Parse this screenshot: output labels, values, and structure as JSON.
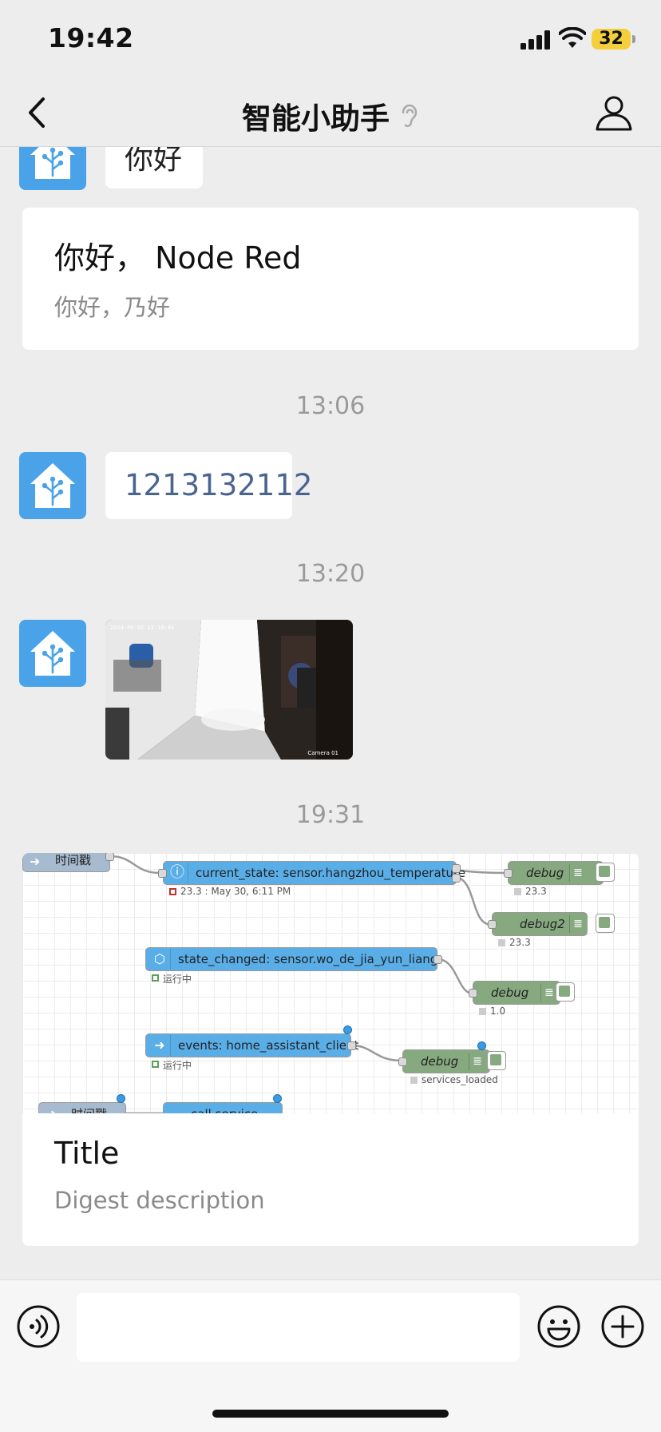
{
  "status_bar": {
    "time": "19:42",
    "battery": "32"
  },
  "header": {
    "title": "智能小助手"
  },
  "messages": {
    "partial_bubble": "你好",
    "card1": {
      "title": "你好， Node Red",
      "desc": "你好，乃好"
    },
    "time1": "13:06",
    "text_bubble": "1213132112",
    "time2": "13:20",
    "image_caption_top": "2024-06-02 13:14:44",
    "image_caption_bottom": "Camera 01",
    "time3": "19:31",
    "card2": {
      "title": "Title",
      "desc": "Digest description"
    }
  },
  "flow": {
    "nodes": {
      "timestamp1": "时间戳",
      "current_state": "current_state: sensor.hangzhou_temperature",
      "current_state_status": "23.3 : May 30, 6:11 PM",
      "debug1": "debug",
      "debug1_status": "23.3",
      "debug2": "debug2",
      "debug2_status": "23.3",
      "state_changed": "state_changed: sensor.wo_de_jia_yun_liang",
      "state_changed_status": "运行中",
      "debug3": "debug",
      "debug3_status": "1.0",
      "events": "events: home_assistant_client",
      "events_status": "运行中",
      "debug4": "debug",
      "debug4_status": "services_loaded",
      "timestamp2": "时间戳",
      "call_service": "call service"
    }
  }
}
